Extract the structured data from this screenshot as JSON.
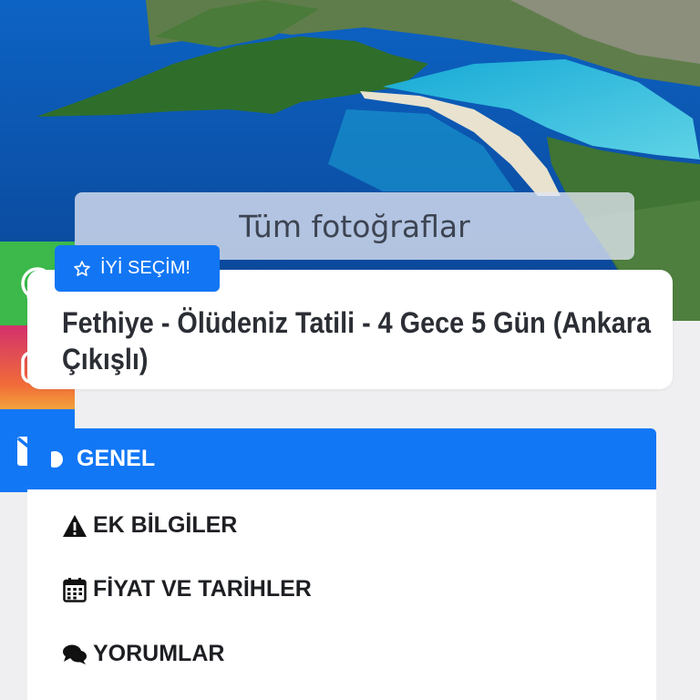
{
  "hero": {
    "photos_button_label": "Tüm fotoğraflar"
  },
  "badge": {
    "label": "İYİ SEÇİM!",
    "icon": "star-outline-icon"
  },
  "title": "Fethiye - Ölüdeniz Tatili - 4 Gece 5 Gün (Ankara Çıkışlı)",
  "social": {
    "items": [
      {
        "icon": "whatsapp-icon",
        "color": "#3cb94a"
      },
      {
        "icon": "instagram-icon",
        "color": "#e1306c"
      },
      {
        "icon": "mail-icon",
        "color": "#1277f5"
      }
    ]
  },
  "tabs": {
    "active": {
      "label": "GENEL",
      "icon": "info-circle-icon"
    },
    "items": [
      {
        "label": "EK BİLGİLER",
        "icon": "warning-icon"
      },
      {
        "label": "FİYAT VE TARİHLER",
        "icon": "calendar-icon"
      },
      {
        "label": "YORUMLAR",
        "icon": "comments-icon"
      }
    ]
  },
  "colors": {
    "accent": "#1277f5",
    "background": "#efeff1",
    "title_text": "#2b2e34"
  }
}
